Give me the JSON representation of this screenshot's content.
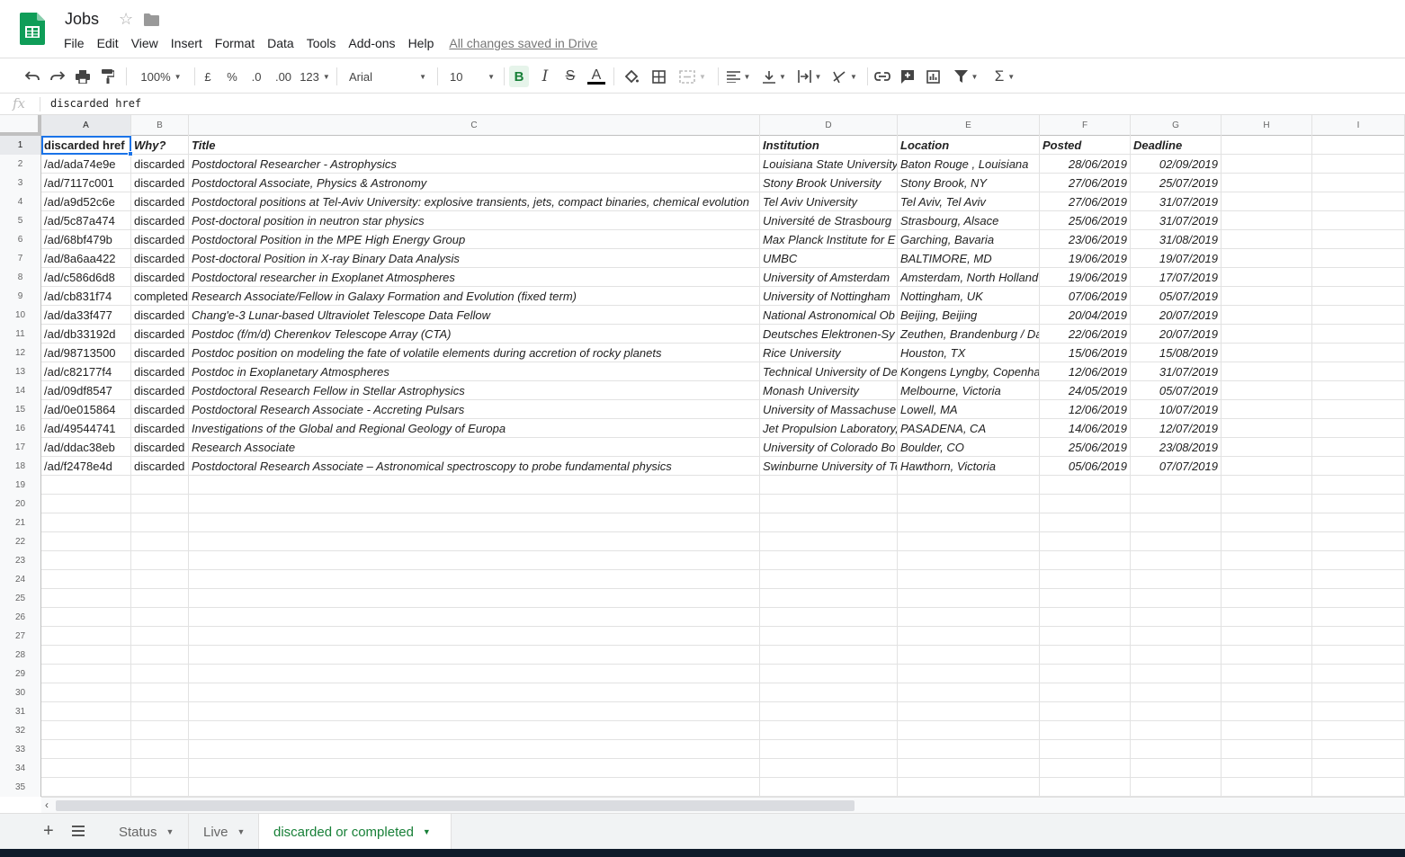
{
  "header": {
    "doc_title": "Jobs",
    "menu": [
      "File",
      "Edit",
      "View",
      "Insert",
      "Format",
      "Data",
      "Tools",
      "Add-ons",
      "Help"
    ],
    "saved_status": "All changes saved in Drive"
  },
  "toolbar": {
    "zoom": "100%",
    "currency": "£",
    "percent": "%",
    "decimal_less": ".0",
    "decimal_more": ".00",
    "number_format": "123",
    "font": "Arial",
    "font_size": "10",
    "bold": "B",
    "italic": "I",
    "strike": "S",
    "text_color": "A",
    "sum": "Σ"
  },
  "formula_bar": {
    "fx": "fx",
    "value": "discarded href"
  },
  "columns": [
    "A",
    "B",
    "C",
    "D",
    "E",
    "F",
    "G",
    "H",
    "I"
  ],
  "rows": [
    [
      "discarded href",
      "Why?",
      "Title",
      "Institution",
      "Location",
      "Posted",
      "Deadline"
    ],
    [
      "/ad/ada74e9e",
      "discarded",
      "Postdoctoral Researcher - Astrophysics",
      "Louisiana State University",
      "Baton Rouge , Louisiana",
      "28/06/2019",
      "02/09/2019"
    ],
    [
      "/ad/7117c001",
      "discarded",
      "Postdoctoral Associate, Physics & Astronomy",
      "Stony Brook University",
      "Stony Brook, NY",
      "27/06/2019",
      "25/07/2019"
    ],
    [
      "/ad/a9d52c6e",
      "discarded",
      "Postdoctoral positions at Tel-Aviv University: explosive transients, jets, compact binaries, chemical evolution",
      "Tel Aviv University",
      "Tel Aviv, Tel Aviv",
      "27/06/2019",
      "31/07/2019"
    ],
    [
      "/ad/5c87a474",
      "discarded",
      "Post-doctoral position in neutron star physics",
      "Université de Strasbourg",
      "Strasbourg, Alsace",
      "25/06/2019",
      "31/07/2019"
    ],
    [
      "/ad/68bf479b",
      "discarded",
      "Postdoctoral Position in the MPE High Energy Group",
      "Max Planck Institute for E",
      "Garching, Bavaria",
      "23/06/2019",
      "31/08/2019"
    ],
    [
      "/ad/8a6aa422",
      "discarded",
      "Post-doctoral Position in X-ray Binary Data Analysis",
      "UMBC",
      "BALTIMORE, MD",
      "19/06/2019",
      "19/07/2019"
    ],
    [
      "/ad/c586d6d8",
      "discarded",
      "Postdoctoral researcher in Exoplanet Atmospheres",
      "University of Amsterdam",
      "Amsterdam, North Holland",
      "19/06/2019",
      "17/07/2019"
    ],
    [
      "/ad/cb831f74",
      "completed",
      "Research Associate/Fellow in Galaxy Formation and Evolution (fixed term)",
      "University of Nottingham",
      "Nottingham, UK",
      "07/06/2019",
      "05/07/2019"
    ],
    [
      "/ad/da33f477",
      "discarded",
      "Chang'e-3 Lunar-based Ultraviolet Telescope Data Fellow",
      "National Astronomical Ob",
      "Beijing, Beijing",
      "20/04/2019",
      "20/07/2019"
    ],
    [
      "/ad/db33192d",
      "discarded",
      "Postdoc (f/m/d) Cherenkov Telescope Array (CTA)",
      "Deutsches Elektronen-Sy",
      "Zeuthen, Brandenburg / Da",
      "22/06/2019",
      "20/07/2019"
    ],
    [
      "/ad/98713500",
      "discarded",
      "Postdoc position on modeling the fate of volatile elements during accretion of rocky planets",
      "Rice University",
      "Houston, TX",
      "15/06/2019",
      "15/08/2019"
    ],
    [
      "/ad/c82177f4",
      "discarded",
      "Postdoc in Exoplanetary Atmospheres",
      "Technical University of De",
      "Kongens Lyngby, Copenha",
      "12/06/2019",
      "31/07/2019"
    ],
    [
      "/ad/09df8547",
      "discarded",
      "Postdoctoral Research Fellow in Stellar Astrophysics",
      "Monash University",
      "Melbourne, Victoria",
      "24/05/2019",
      "05/07/2019"
    ],
    [
      "/ad/0e015864",
      "discarded",
      "Postdoctoral Research Associate - Accreting Pulsars",
      "University of Massachuse",
      "Lowell, MA",
      "12/06/2019",
      "10/07/2019"
    ],
    [
      "/ad/49544741",
      "discarded",
      "Investigations of the Global and Regional Geology of Europa",
      "Jet Propulsion Laboratory,",
      "PASADENA, CA",
      "14/06/2019",
      "12/07/2019"
    ],
    [
      "/ad/ddac38eb",
      "discarded",
      "Research Associate",
      "University of Colorado Bo",
      "Boulder, CO",
      "25/06/2019",
      "23/08/2019"
    ],
    [
      "/ad/f2478e4d",
      "discarded",
      "Postdoctoral Research Associate – Astronomical spectroscopy to probe fundamental physics",
      "Swinburne University of Te",
      "Hawthorn, Victoria",
      "05/06/2019",
      "07/07/2019"
    ]
  ],
  "row_numbers": [
    "1",
    "2",
    "3",
    "4",
    "5",
    "6",
    "7",
    "8",
    "9",
    "10",
    "11",
    "12",
    "13",
    "14",
    "15",
    "16",
    "17",
    "18",
    "19",
    "20",
    "21",
    "22",
    "23",
    "24",
    "25",
    "26",
    "27",
    "28",
    "29",
    "30",
    "31",
    "32",
    "33",
    "34",
    "35"
  ],
  "sheets": [
    {
      "label": "Status",
      "active": false
    },
    {
      "label": "Live",
      "active": false
    },
    {
      "label": "discarded or completed",
      "active": true
    }
  ],
  "colors": {
    "accent_green": "#188038",
    "selection_blue": "#1a73e8",
    "sheets_logo": "#0f9d58"
  }
}
